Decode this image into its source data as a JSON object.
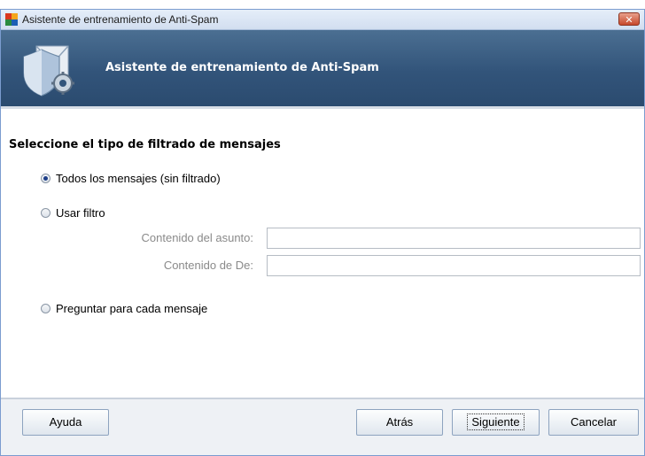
{
  "window": {
    "title": "Asistente de entrenamiento de Anti-Spam",
    "close_label": "✕"
  },
  "banner": {
    "title": "Asistente de entrenamiento de Anti-Spam"
  },
  "content": {
    "section_title": "Seleccione el tipo de filtrado de mensajes",
    "options": [
      {
        "label": "Todos los mensajes (sin filtrado)",
        "checked": true
      },
      {
        "label": "Usar filtro",
        "checked": false
      },
      {
        "label": "Preguntar para cada mensaje",
        "checked": false
      }
    ],
    "fields": [
      {
        "label": "Contenido del asunto:",
        "value": ""
      },
      {
        "label": "Contenido de De:",
        "value": ""
      }
    ]
  },
  "footer": {
    "help_label": "Ayuda",
    "back_label": "Atrás",
    "next_label": "Siguiente",
    "cancel_label": "Cancelar"
  },
  "colors": {
    "banner": "#32547a",
    "footer": "#eef1f5",
    "close": "#c7482b"
  }
}
